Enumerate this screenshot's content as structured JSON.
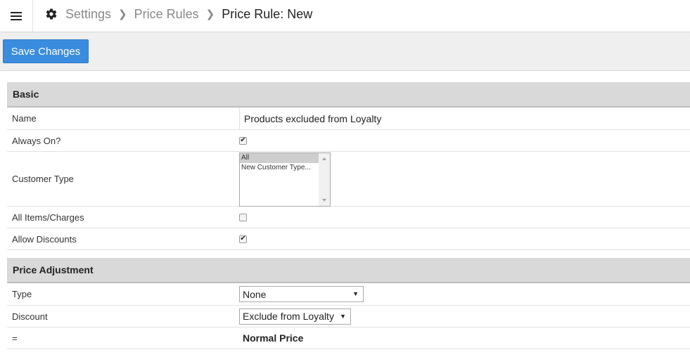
{
  "header": {
    "breadcrumb": [
      "Settings",
      "Price Rules"
    ],
    "current": "Price Rule: New",
    "icons": {
      "menu": "hamburger-menu-icon",
      "settings": "gear-icon",
      "separator": "chevron-right-icon"
    }
  },
  "toolbar": {
    "save_label": "Save Changes",
    "save_color": "#3a8dde"
  },
  "basic": {
    "title": "Basic",
    "name_label": "Name",
    "name_value": "Products excluded from Loyalty",
    "always_on_label": "Always On?",
    "always_on_checked": true,
    "customer_type_label": "Customer Type",
    "customer_type_options": [
      "All",
      "New Customer Type..."
    ],
    "customer_type_selected": "All",
    "all_items_label": "All Items/Charges",
    "all_items_checked": false,
    "allow_discounts_label": "Allow Discounts",
    "allow_discounts_checked": true
  },
  "price_adjustment": {
    "title": "Price Adjustment",
    "type_label": "Type",
    "type_value": "None",
    "discount_label": "Discount",
    "discount_value": "Exclude from Loyalty",
    "result_label": "=",
    "result_value": "Normal Price"
  }
}
